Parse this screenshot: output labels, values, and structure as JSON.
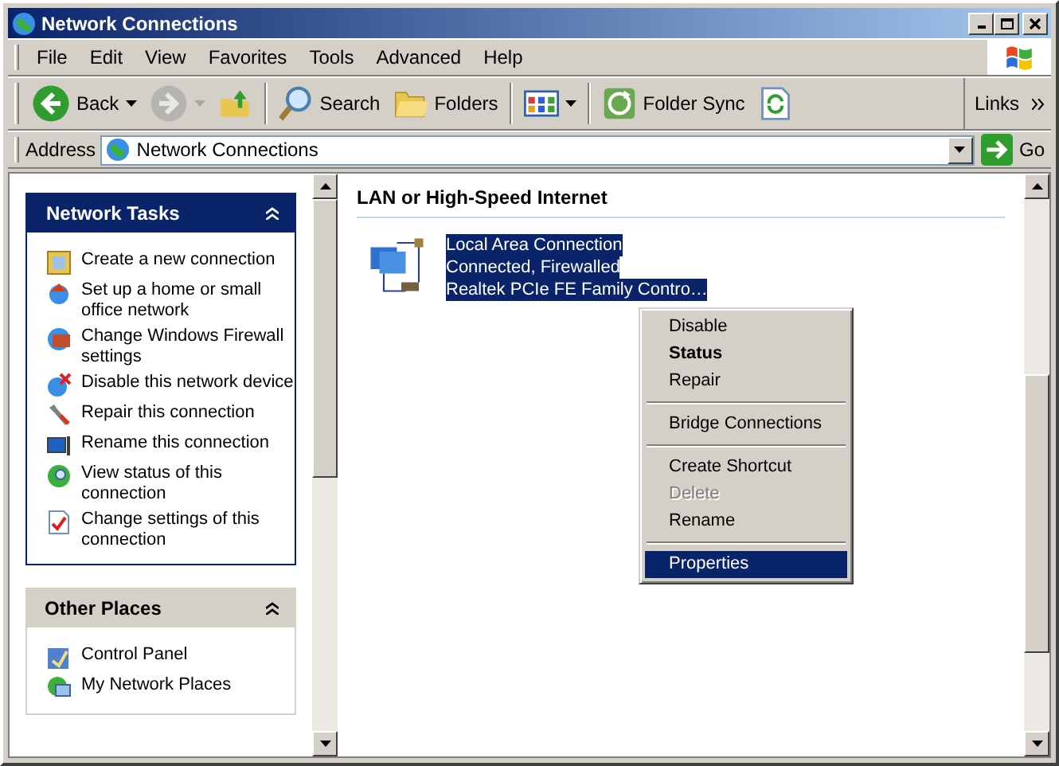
{
  "window": {
    "title": "Network Connections"
  },
  "menu": [
    "File",
    "Edit",
    "View",
    "Favorites",
    "Tools",
    "Advanced",
    "Help"
  ],
  "toolbar": [
    {
      "kind": "back",
      "label": "Back",
      "disabled": false
    },
    {
      "kind": "forward",
      "disabled": true
    },
    {
      "kind": "up",
      "disabled": false
    },
    {
      "kind": "search",
      "label": "Search",
      "disabled": false
    },
    {
      "kind": "folders",
      "label": "Folders",
      "disabled": false
    },
    {
      "kind": "views",
      "disabled": false
    },
    {
      "kind": "sync",
      "label": "Folder Sync",
      "disabled": false
    },
    {
      "kind": "refresh",
      "disabled": false
    }
  ],
  "links": "Links",
  "address": {
    "label": "Address",
    "value": "Network Connections",
    "go": "Go"
  },
  "task_panels": [
    {
      "title": "Network Tasks",
      "items": [
        {
          "label": "Create a new connection"
        },
        {
          "label": "Set up a home or small office network"
        },
        {
          "label": "Change Windows Firewall settings"
        },
        {
          "label": "Disable this network device"
        },
        {
          "label": "Repair this connection"
        },
        {
          "label": "Rename this connection"
        },
        {
          "label": "View status of this connection"
        },
        {
          "label": "Change settings of this connection"
        }
      ]
    },
    {
      "title": "Other Places",
      "items": [
        {
          "label": "Control Panel"
        },
        {
          "label": "My Network Places"
        }
      ]
    }
  ],
  "section": {
    "title": "LAN or High-Speed Internet",
    "connections": [
      {
        "name": "Local Area Connection",
        "status": "Connected, Firewalled",
        "device": "Realtek PCIe FE Family Contro…",
        "selected": true
      }
    ]
  },
  "context_menu": [
    {
      "kind": "item",
      "label": "Disable",
      "bold": false,
      "disabled": false,
      "selected": false
    },
    {
      "kind": "item",
      "label": "Status",
      "bold": true,
      "disabled": false,
      "selected": false
    },
    {
      "kind": "item",
      "label": "Repair",
      "bold": false,
      "disabled": false,
      "selected": false
    },
    {
      "kind": "separator"
    },
    {
      "kind": "item",
      "label": "Bridge Connections",
      "bold": false,
      "disabled": false,
      "selected": false
    },
    {
      "kind": "separator"
    },
    {
      "kind": "item",
      "label": "Create Shortcut",
      "bold": false,
      "disabled": false,
      "selected": false
    },
    {
      "kind": "item",
      "label": "Delete",
      "bold": false,
      "disabled": true,
      "selected": false
    },
    {
      "kind": "item",
      "label": "Rename",
      "bold": false,
      "disabled": false,
      "selected": false
    },
    {
      "kind": "separator"
    },
    {
      "kind": "item",
      "label": "Properties",
      "bold": false,
      "disabled": false,
      "selected": true
    }
  ]
}
